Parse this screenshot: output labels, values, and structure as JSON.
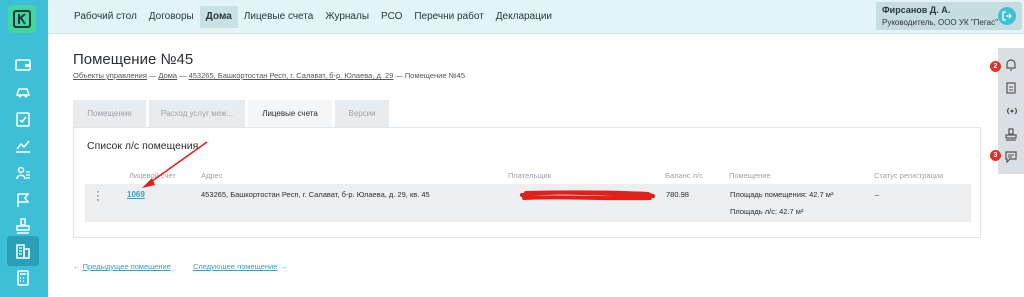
{
  "sidebar": {
    "logo_letter": "K",
    "icons": [
      "wallet-icon",
      "vehicle-icon",
      "clipboard-check-icon",
      "chart-icon",
      "people-icon",
      "flag-icon",
      "stamp-icon",
      "building-icon",
      "calculator-icon"
    ]
  },
  "topnav": {
    "items": [
      "Рабочий стол",
      "Договоры",
      "Дома",
      "Лицевые счета",
      "Журналы",
      "РСО",
      "Перечни работ",
      "Декларации"
    ],
    "active_index": 2
  },
  "user": {
    "name": "Фирсанов Д. А.",
    "role": "Руководитель, ООО УК \"Пегас\""
  },
  "right_panel": {
    "notifications_badge": "2",
    "messages_badge": "3"
  },
  "page": {
    "title": "Помещение №45",
    "breadcrumb": [
      "Объекты управления",
      "Дома",
      "453265, Башкортостан Респ, г. Салават, б-р. Юлаева, д. 29",
      "Помещение №45"
    ]
  },
  "tabs": [
    "Помещение",
    "Расход услуг меж...",
    "Лицевые счета",
    "Версии"
  ],
  "active_tab": 2,
  "list": {
    "title": "Список л/с помещения",
    "headers": [
      "Лицевой счет",
      "Адрес",
      "Плательщик",
      "Баланс л/с",
      "Помещение",
      "Статус регистрации"
    ],
    "rows": [
      {
        "account": "1069",
        "address": "453265, Башкортостан Респ, г. Салават, б-р. Юлаева, д. 29, кв. 45",
        "balance": "780.98",
        "area_room": "Площадь помещения: 42.7 м²",
        "area_account": "Площадь л/с: 42.7 м²",
        "status": "–"
      }
    ]
  },
  "pager": {
    "prev": "Предыдущее помещение",
    "next": "Следующее помещение"
  },
  "colors": {
    "sidebar": "#3dbfd8",
    "logo": "#43d6a0",
    "topnav": "#e3f4f4",
    "link": "#2fa5c4",
    "badge": "#d9352b",
    "annotation_red": "#e0201a"
  }
}
